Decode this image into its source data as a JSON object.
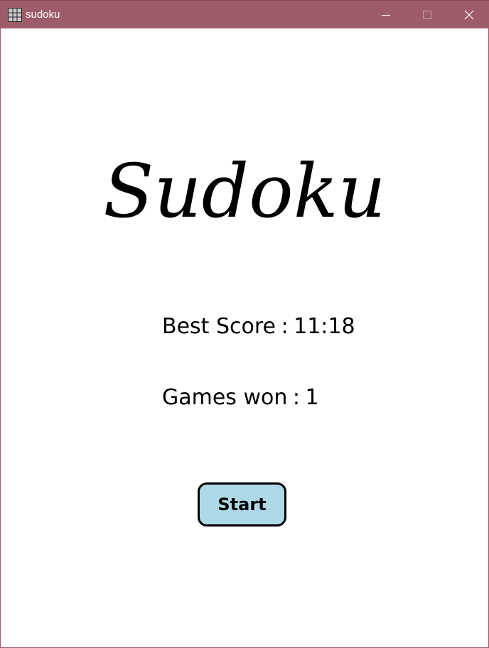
{
  "window": {
    "title": "sudoku",
    "app_icon": "grid-icon",
    "controls": {
      "minimize_icon": "minimize-icon",
      "maximize_icon": "maximize-icon",
      "close_icon": "close-icon"
    }
  },
  "logo": {
    "text": "Sudoku"
  },
  "stats": {
    "best_score_label": "Best Score",
    "best_score_value": "11:18",
    "games_won_label": "Games won",
    "games_won_value": "1",
    "separator": ":"
  },
  "start_button": {
    "label": "Start"
  },
  "colors": {
    "titlebar": "#9e5c69",
    "button_fill": "#add8e6",
    "button_border": "#000000",
    "background": "#ffffff"
  }
}
